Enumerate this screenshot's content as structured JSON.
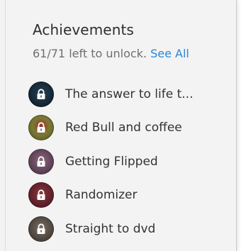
{
  "achievements": {
    "title": "Achievements",
    "summary": "61/71 left to unlock.",
    "see_all_label": "See All",
    "accent_color": "#2a86d8",
    "items": [
      {
        "label": "The answer to life t...",
        "badge_colors": [
          "#1a2e3e",
          "#0b0f18",
          "#223f55"
        ],
        "icon": "lock-icon"
      },
      {
        "label": "Red Bull and coffee",
        "badge_colors": [
          "#7b7a34",
          "#4c4a1e",
          "#9a2a2a"
        ],
        "icon": "lock-icon"
      },
      {
        "label": "Getting Flipped",
        "badge_colors": [
          "#6a4a60",
          "#3f2a3c",
          "#8a6a7e"
        ],
        "icon": "lock-icon"
      },
      {
        "label": "Randomizer",
        "badge_colors": [
          "#6a2530",
          "#3a1218",
          "#8a3a3a"
        ],
        "icon": "lock-icon"
      },
      {
        "label": "Straight to dvd",
        "badge_colors": [
          "#5a5048",
          "#2e2824",
          "#7a6e62"
        ],
        "icon": "lock-icon"
      }
    ]
  }
}
